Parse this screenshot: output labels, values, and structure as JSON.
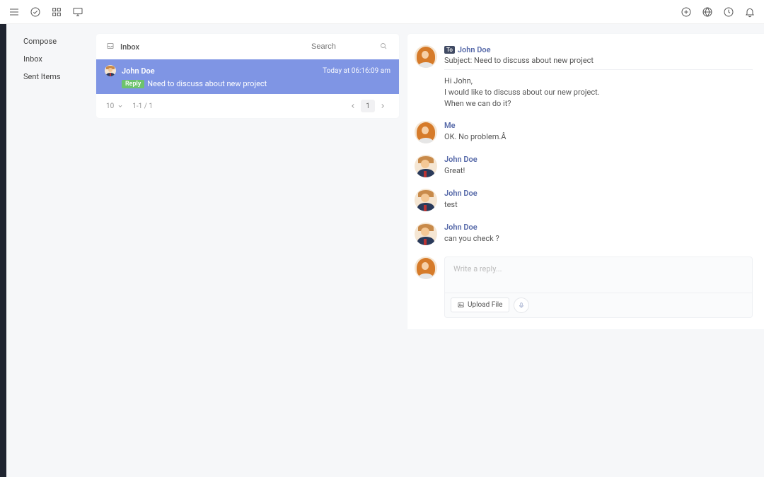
{
  "sidebar": {
    "items": [
      {
        "label": "Compose"
      },
      {
        "label": "Inbox"
      },
      {
        "label": "Sent Items"
      }
    ]
  },
  "list": {
    "title": "Inbox",
    "search_placeholder": "Search",
    "rows": [
      {
        "sender": "John Doe",
        "time": "Today at 06:16:09 am",
        "badge": "Reply",
        "subject": "Need to discuss about new project"
      }
    ],
    "pager": {
      "per_page": "10",
      "range": "1-1 / 1",
      "current": "1"
    }
  },
  "conversation": {
    "messages": [
      {
        "from": "John Doe",
        "avatar": "female",
        "to_badge": "To",
        "subject": "Subject: Need to discuss about new project",
        "text": "Hi John,\nI would like to discuss about our new project.\nWhen we can do it?"
      },
      {
        "from": "Me",
        "avatar": "female",
        "text": "OK. No problem.Â "
      },
      {
        "from": "John Doe",
        "avatar": "male",
        "text": "Great!"
      },
      {
        "from": "John Doe",
        "avatar": "male",
        "text": "test"
      },
      {
        "from": "John Doe",
        "avatar": "male",
        "text": "can you check ?"
      }
    ],
    "reply_placeholder": "Write a reply...",
    "upload_label": "Upload File"
  }
}
